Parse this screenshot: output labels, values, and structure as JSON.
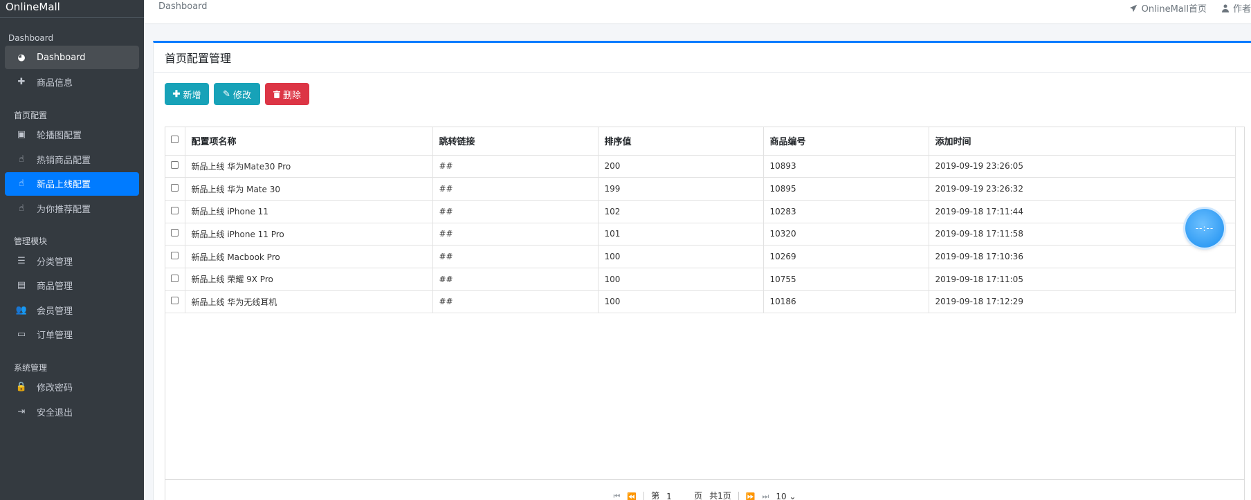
{
  "brand": "OnlineMall",
  "sidebar": {
    "sections": [
      {
        "header": "Dashboard",
        "items": [
          {
            "label": "Dashboard",
            "icon": "dashboard-icon",
            "state": "current"
          },
          {
            "label": "商品信息",
            "icon": "plus-icon",
            "state": ""
          }
        ]
      },
      {
        "header": "首页配置",
        "items": [
          {
            "label": "轮播图配置",
            "icon": "image-icon",
            "state": ""
          },
          {
            "label": "热销商品配置",
            "icon": "hand-pointer-icon",
            "state": ""
          },
          {
            "label": "新品上线配置",
            "icon": "hand-pointer-icon",
            "state": "active"
          },
          {
            "label": "为你推荐配置",
            "icon": "hand-pointer-icon",
            "state": ""
          }
        ]
      },
      {
        "header": "管理模块",
        "items": [
          {
            "label": "分类管理",
            "icon": "list-icon",
            "state": ""
          },
          {
            "label": "商品管理",
            "icon": "archive-icon",
            "state": ""
          },
          {
            "label": "会员管理",
            "icon": "users-icon",
            "state": ""
          },
          {
            "label": "订单管理",
            "icon": "money-icon",
            "state": ""
          }
        ]
      },
      {
        "header": "系统管理",
        "items": [
          {
            "label": "修改密码",
            "icon": "lock-icon",
            "state": ""
          },
          {
            "label": "安全退出",
            "icon": "sign-out-icon",
            "state": ""
          }
        ]
      }
    ]
  },
  "topbar": {
    "breadcrumb": "Dashboard",
    "home_link": "OnlineMall首页",
    "user_link": "作者"
  },
  "card": {
    "title": "首页配置管理",
    "buttons": {
      "add": "新增",
      "edit": "修改",
      "delete": "删除"
    }
  },
  "table": {
    "columns": [
      "配置项名称",
      "跳转链接",
      "排序值",
      "商品编号",
      "添加时间"
    ],
    "rows": [
      [
        "新品上线 华为Mate30 Pro",
        "##",
        "200",
        "10893",
        "2019-09-19 23:26:05"
      ],
      [
        "新品上线 华为 Mate 30",
        "##",
        "199",
        "10895",
        "2019-09-19 23:26:32"
      ],
      [
        "新品上线 iPhone 11",
        "##",
        "102",
        "10283",
        "2019-09-18 17:11:44"
      ],
      [
        "新品上线 iPhone 11 Pro",
        "##",
        "101",
        "10320",
        "2019-09-18 17:11:58"
      ],
      [
        "新品上线 Macbook Pro",
        "##",
        "100",
        "10269",
        "2019-09-18 17:10:36"
      ],
      [
        "新品上线 荣耀 9X Pro",
        "##",
        "100",
        "10755",
        "2019-09-18 17:11:05"
      ],
      [
        "新品上线 华为无线耳机",
        "##",
        "100",
        "10186",
        "2019-09-18 17:12:29"
      ]
    ]
  },
  "pager": {
    "page_prefix": "第",
    "page_value": "1",
    "page_suffix": "页",
    "total": "共1页",
    "page_size": "10"
  },
  "floatball": {
    "text": "--:--"
  },
  "colors": {
    "primary": "#007bff",
    "info": "#17a2b8",
    "danger": "#dc3545",
    "sidebar": "#343a40"
  }
}
